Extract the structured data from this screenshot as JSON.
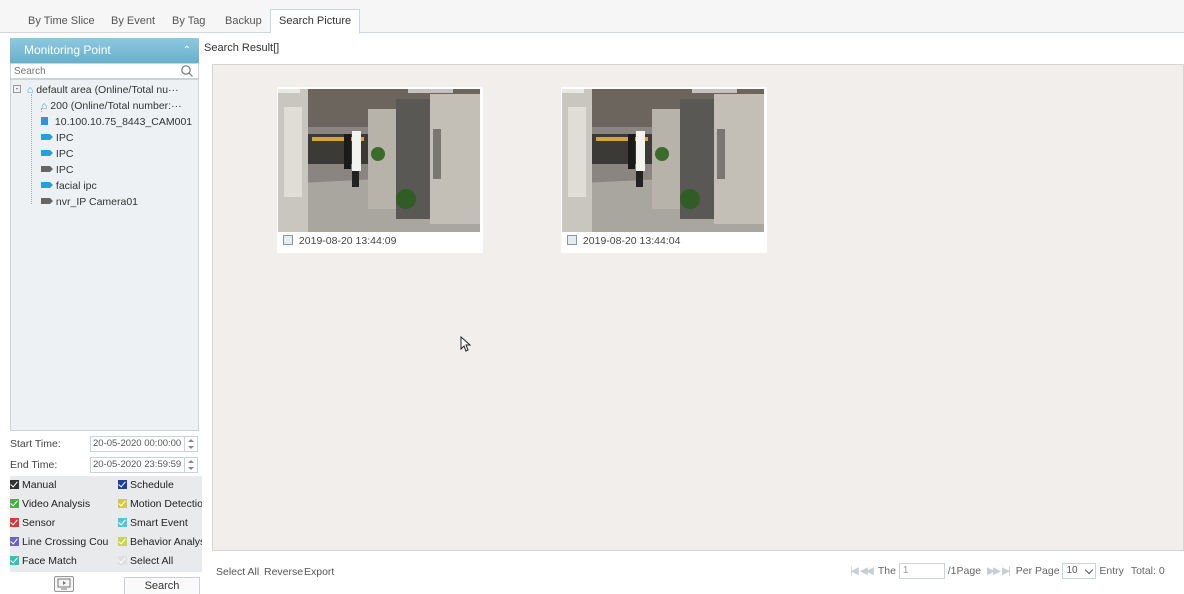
{
  "tabs": [
    "By Time Slice",
    "By Event",
    "By Tag",
    "Backup",
    "Search Picture"
  ],
  "active_tab": "Search Picture",
  "sidebar": {
    "title": "Monitoring Point",
    "search_placeholder": "Search",
    "tree": [
      {
        "label": "default area (Online/Total nu···",
        "icon": "home-icon"
      },
      {
        "label": "200 (Online/Total number:···",
        "icon": "home-icon"
      },
      {
        "label": "10.100.10.75_8443_CAM001",
        "icon": "nvr-icon",
        "color": "#3a8fd9"
      },
      {
        "label": "IPC",
        "icon": "camera-icon",
        "color": "#2a9fd6"
      },
      {
        "label": "IPC",
        "icon": "camera-icon",
        "color": "#2a9fd6"
      },
      {
        "label": "IPC",
        "icon": "camera-icon",
        "color": "#666666"
      },
      {
        "label": "facial ipc",
        "icon": "camera-icon",
        "color": "#2a9fd6"
      },
      {
        "label": "nvr_IP Camera01",
        "icon": "camera-icon",
        "color": "#666666"
      }
    ],
    "start_time_label": "Start Time:",
    "start_time_value": "20-05-2020 00:00:00",
    "end_time_label": "End Time:",
    "end_time_value": "20-05-2020 23:59:59",
    "filters": [
      {
        "label": "Manual",
        "color": "#333333"
      },
      {
        "label": "Schedule",
        "color": "#1e3f9e"
      },
      {
        "label": "Video Analysis",
        "color": "#42b540"
      },
      {
        "label": "Motion Detection",
        "color": "#d6c93a"
      },
      {
        "label": "Sensor",
        "color": "#d33a3a"
      },
      {
        "label": "Smart Event",
        "color": "#52c7d8"
      },
      {
        "label": "Line Crossing Cou",
        "color": "#6b62c7"
      },
      {
        "label": "Behavior Analysis",
        "color": "#c9d64a"
      },
      {
        "label": "Face Match",
        "color": "#3cbdb0"
      },
      {
        "label": "Select All",
        "color": "#e0e0e0"
      }
    ],
    "search_button": "Search"
  },
  "main": {
    "title": "Search Result[]",
    "results": [
      {
        "timestamp": "2019-08-20 13:44:09"
      },
      {
        "timestamp": "2019-08-20 13:44:04"
      }
    ],
    "footer": {
      "select_all": "Select All",
      "reverse": "Reverse",
      "export": "Export",
      "the_label": "The",
      "page_value": "1",
      "page_suffix": "/1Page",
      "per_page_label": "Per Page",
      "per_page_value": "10",
      "entry_label": "Entry",
      "total_label": "Total: 0"
    }
  }
}
